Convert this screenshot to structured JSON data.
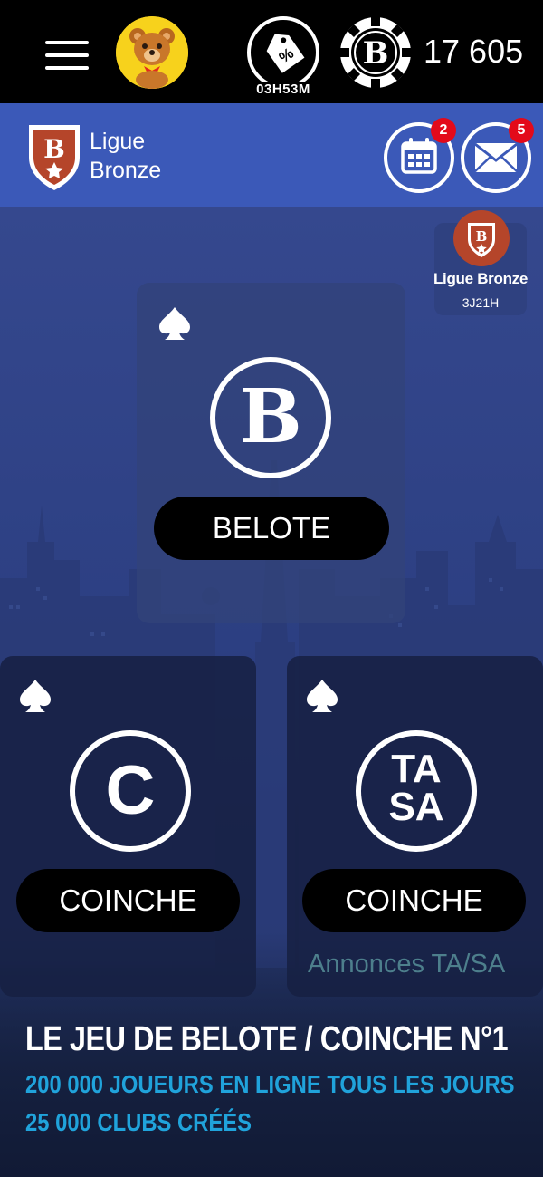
{
  "topbar": {
    "menu_icon": "hamburger-menu-icon",
    "avatar_icon": "teddy-bear-avatar",
    "promo_icon": "percent-tag-icon",
    "promo_timer": "03H53M",
    "coin_icon": "belote-chip-icon",
    "coin_amount": "17 605"
  },
  "league": {
    "shield_letter": "B",
    "label_line1": "Ligue",
    "label_line2": "Bronze",
    "calendar_badge": "2",
    "mail_badge": "5",
    "chip_title": "Ligue Bronze",
    "chip_time": "3J21H"
  },
  "games": {
    "belote": {
      "logo": "B",
      "label": "BELOTE"
    },
    "coinche": {
      "logo": "C",
      "label": "COINCHE"
    },
    "tasa": {
      "logo_line1": "TA",
      "logo_line2": "SA",
      "label": "COINCHE",
      "subtitle": "Annonces TA/SA"
    }
  },
  "footer": {
    "headline": "LE JEU DE BELOTE / COINCHE N°1",
    "line2": "200 000 JOUEURS EN LIGNE TOUS LES JOURS",
    "line3": "25 000 CLUBS CRÉÉS"
  },
  "colors": {
    "topbar": "#000000",
    "league_bar": "#3b59b8",
    "badge": "#e30a1a",
    "shield": "#b5452a",
    "accent_blue": "#20a3db",
    "teal_text": "#4d7f8c"
  }
}
